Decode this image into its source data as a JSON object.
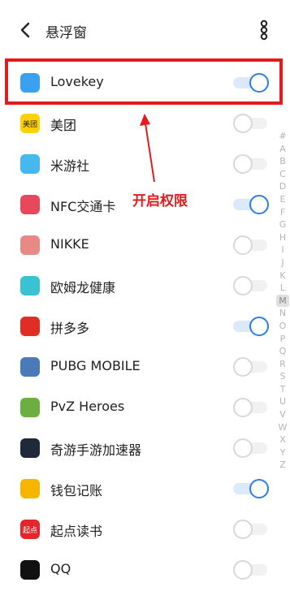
{
  "header": {
    "title": "悬浮窗"
  },
  "annotation": {
    "text": "开启权限"
  },
  "apps": [
    {
      "name": "Lovekey",
      "enabled": true,
      "icon": "lovekey-icon",
      "color": "#3aa0f0"
    },
    {
      "name": "美团",
      "enabled": false,
      "icon": "meituan-icon",
      "color": "#ffd100",
      "icon_text": "美团"
    },
    {
      "name": "米游社",
      "enabled": false,
      "icon": "miyoushe-icon",
      "color": "#45b8f0"
    },
    {
      "name": "NFC交通卡",
      "enabled": true,
      "icon": "nfc-card-icon",
      "color": "#e9475b"
    },
    {
      "name": "NIKKE",
      "enabled": false,
      "icon": "nikke-icon",
      "color": "#e78a86"
    },
    {
      "name": "欧姆龙健康",
      "enabled": false,
      "icon": "omron-icon",
      "color": "#39c2d1"
    },
    {
      "name": "拼多多",
      "enabled": true,
      "icon": "pinduoduo-icon",
      "color": "#e02e24"
    },
    {
      "name": "PUBG MOBILE",
      "enabled": false,
      "icon": "pubg-icon",
      "color": "#4a7bb8"
    },
    {
      "name": "PvZ Heroes",
      "enabled": false,
      "icon": "pvz-icon",
      "color": "#6cae3f"
    },
    {
      "name": "奇游手游加速器",
      "enabled": false,
      "icon": "qiyou-icon",
      "color": "#1e2a3a"
    },
    {
      "name": "钱包记账",
      "enabled": true,
      "icon": "wallet-icon",
      "color": "#f7b500"
    },
    {
      "name": "起点读书",
      "enabled": false,
      "icon": "qidian-icon",
      "color": "#e5252a",
      "icon_text": "起点"
    },
    {
      "name": "QQ",
      "enabled": false,
      "icon": "qq-icon",
      "color": "#111111"
    }
  ],
  "index_letters": [
    "#",
    "A",
    "B",
    "C",
    "D",
    "E",
    "F",
    "G",
    "H",
    "I",
    "J",
    "K",
    "L",
    "M",
    "N",
    "O",
    "P",
    "Q",
    "R",
    "S",
    "T",
    "U",
    "V",
    "W",
    "X",
    "Y",
    "Z"
  ],
  "active_letter": "M"
}
